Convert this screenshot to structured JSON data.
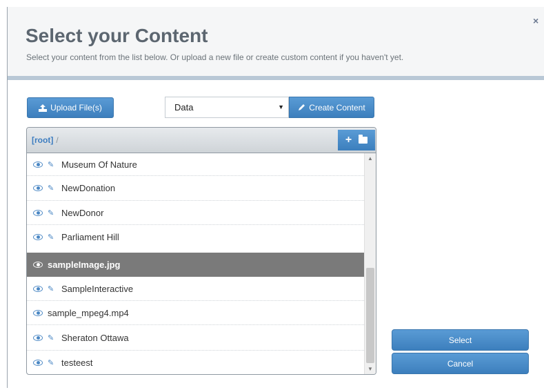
{
  "dialog": {
    "title": "Select your Content",
    "subtitle": "Select your content from the list below. Or upload a new file or create custom content if you haven't yet.",
    "close_label": "×"
  },
  "toolbar": {
    "upload_label": "Upload File(s)",
    "type_select_value": "Data",
    "create_label": "Create Content"
  },
  "browser": {
    "breadcrumb_root": "[root]",
    "breadcrumb_sep": "/",
    "add_label": "+",
    "items": [
      {
        "label": "Museum Of Nature",
        "editable": true,
        "selected": false
      },
      {
        "label": "NewDonation",
        "editable": true,
        "selected": false
      },
      {
        "label": "NewDonor",
        "editable": true,
        "selected": false
      },
      {
        "label": "Parliament Hill",
        "editable": true,
        "selected": false
      },
      {
        "label": "sampleImage.jpg",
        "editable": false,
        "selected": true
      },
      {
        "label": "SampleInteractive",
        "editable": true,
        "selected": false
      },
      {
        "label": "sample_mpeg4.mp4",
        "editable": false,
        "selected": false
      },
      {
        "label": "Sheraton Ottawa",
        "editable": true,
        "selected": false
      },
      {
        "label": "testeest",
        "editable": true,
        "selected": false
      }
    ]
  },
  "actions": {
    "select_label": "Select",
    "cancel_label": "Cancel"
  },
  "colors": {
    "accent": "#3c7fbd",
    "selected_row": "#7a7a7a"
  }
}
